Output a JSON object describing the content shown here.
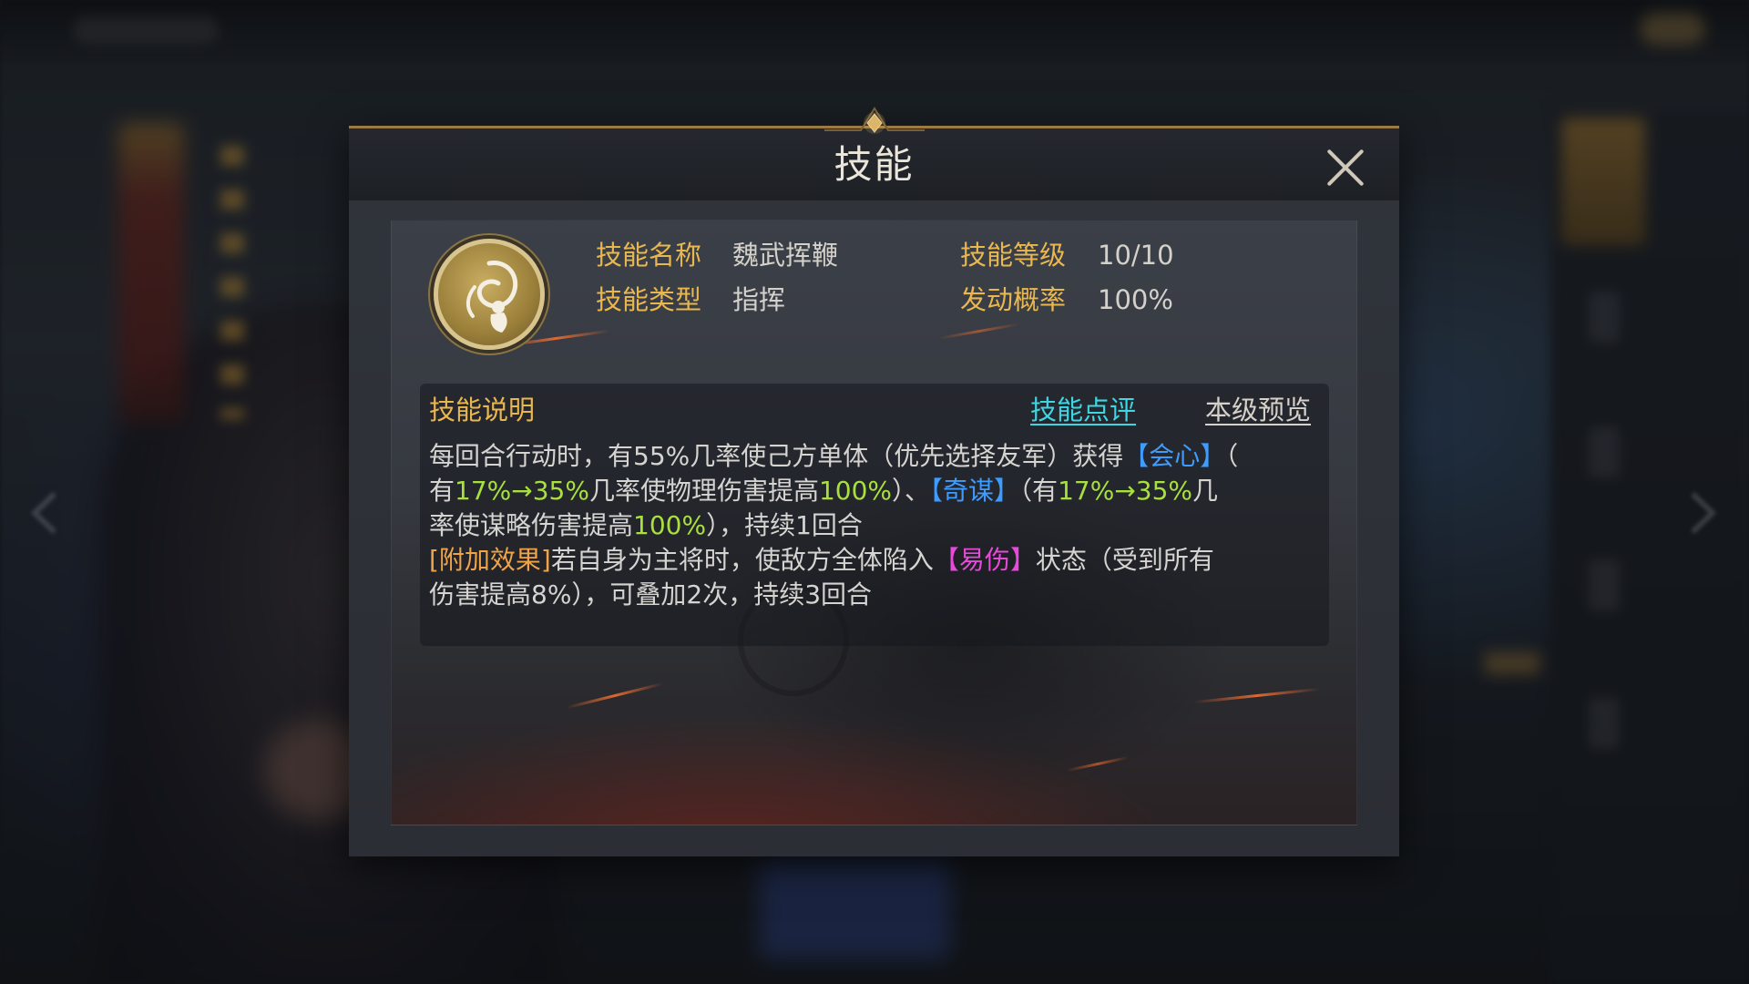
{
  "window": {
    "title": "技能",
    "close_icon": "close-icon"
  },
  "background": {
    "prev_icon": "chevron-left-icon",
    "next_icon": "chevron-right-icon"
  },
  "skill": {
    "icon": "whip-icon",
    "name_label": "技能名称",
    "name": "魏武挥鞭",
    "level_label": "技能等级",
    "level": "10/10",
    "type_label": "技能类型",
    "type": "指挥",
    "chance_label": "发动概率",
    "chance": "100%"
  },
  "description": {
    "title": "技能说明",
    "review_link": "技能点评",
    "preview_link": "本级预览",
    "lines": [
      [
        {
          "text": "每回合行动时，有55%几率使己方单体（优先选择友军）获得"
        },
        {
          "text": "【会心】"
        },
        {
          "text": "（"
        }
      ],
      [
        {
          "text": "有"
        },
        {
          "text": "17%→35%"
        },
        {
          "text": "几率使物理伤害提高"
        },
        {
          "text": "100%"
        },
        {
          "text": "）、"
        },
        {
          "text": "【奇谋】"
        },
        {
          "text": "（有"
        },
        {
          "text": "17%→35%"
        },
        {
          "text": "几"
        }
      ],
      [
        {
          "text": "率使谋略伤害提高"
        },
        {
          "text": "100%"
        },
        {
          "text": "），持续1回合"
        }
      ],
      [
        {
          "text": "[附加效果]"
        },
        {
          "text": "若自身为主将时，使敌方全体陷入"
        },
        {
          "text": "【易伤】"
        },
        {
          "text": "状态（受到所有"
        }
      ],
      [
        {
          "text": "伤害提高8%），可叠加2次，持续3回合"
        }
      ]
    ]
  },
  "colors": {
    "label_gold": "#e9b74f",
    "body_text": "#d6d4d0",
    "highlight_green": "#a8e03c",
    "keyword_blue": "#3f9cff",
    "keyword_magenta": "#e64ad8",
    "extra_effect_orange": "#f0a448",
    "link_cyan": "#3fd6e4",
    "frame_gold": "#9c7a43"
  }
}
